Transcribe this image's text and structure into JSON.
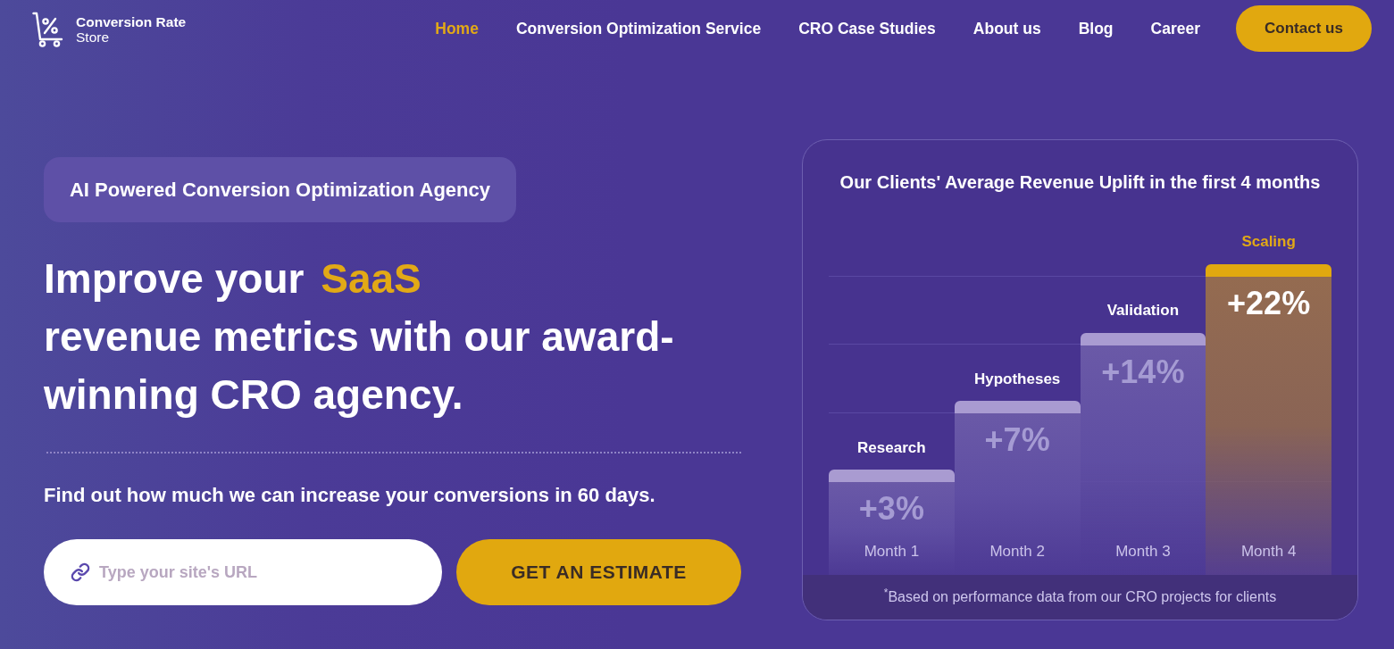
{
  "header": {
    "logo": {
      "name": "Conversion Rate",
      "subtitle": "Store"
    },
    "nav": [
      {
        "label": "Home",
        "selected": true
      },
      {
        "label": "Conversion Optimization Service",
        "selected": false
      },
      {
        "label": "CRO Case Studies",
        "selected": false
      },
      {
        "label": "About us",
        "selected": false
      },
      {
        "label": "Blog",
        "selected": false
      },
      {
        "label": "Career",
        "selected": false
      }
    ],
    "contact_button": "Contact us"
  },
  "hero": {
    "badge": "AI Powered Conversion Optimization Agency",
    "headline": {
      "lead": "Improve your",
      "highlight": "SaaS",
      "rest": "revenue metrics with our award-winning CRO agency."
    },
    "subtitle": "Find out how much we can increase your conversions in 60 days.",
    "url_field": {
      "placeholder": "Type your site's URL"
    },
    "estimate_button": "GET AN ESTIMATE"
  },
  "chart_card": {
    "title": "Our Clients' Average Revenue Uplift in the first 4 months",
    "steps": [
      {
        "stage": "Research",
        "uplift": "+3%",
        "month": "Month 1",
        "highlighted": false
      },
      {
        "stage": "Hypotheses",
        "uplift": "+7%",
        "month": "Month 2",
        "highlighted": false
      },
      {
        "stage": "Validation",
        "uplift": "+14%",
        "month": "Month 3",
        "highlighted": false
      },
      {
        "stage": "Scaling",
        "uplift": "+22%",
        "month": "Month 4",
        "highlighted": true
      }
    ],
    "footnote": "$^{*}$Based on performance data from our CRO projects for clients"
  }
}
